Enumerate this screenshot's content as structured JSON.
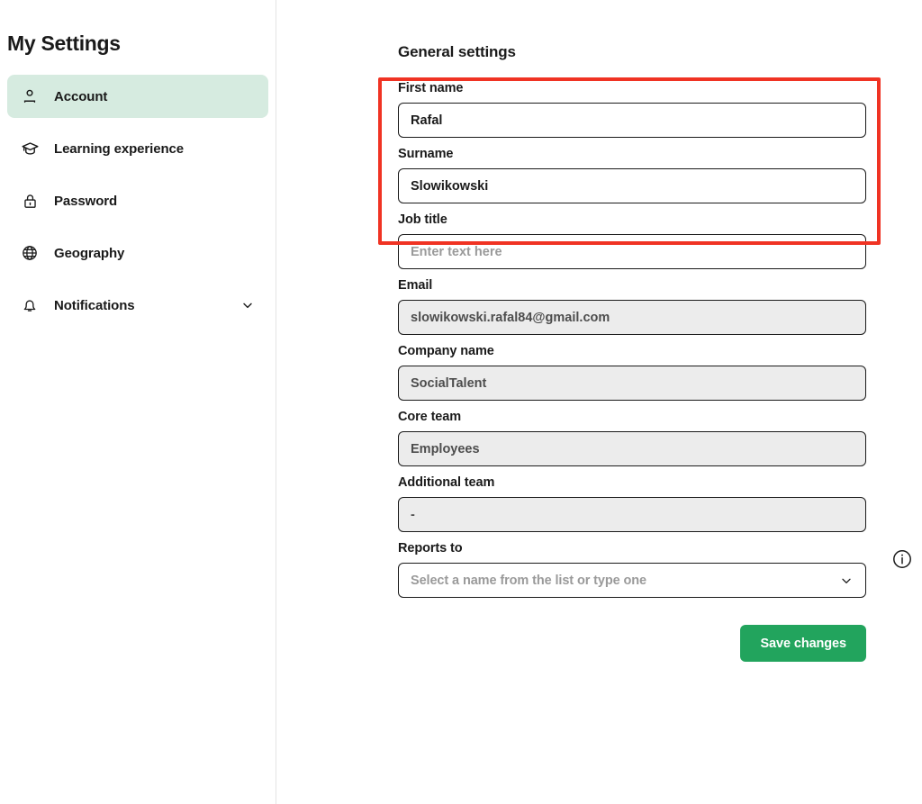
{
  "sidebar": {
    "title": "My Settings",
    "items": [
      {
        "label": "Account",
        "icon": "user-icon",
        "active": true,
        "expandable": false
      },
      {
        "label": "Learning experience",
        "icon": "graduation-cap-icon",
        "active": false,
        "expandable": false
      },
      {
        "label": "Password",
        "icon": "lock-icon",
        "active": false,
        "expandable": false
      },
      {
        "label": "Geography",
        "icon": "globe-icon",
        "active": false,
        "expandable": false
      },
      {
        "label": "Notifications",
        "icon": "bell-icon",
        "active": false,
        "expandable": true
      }
    ]
  },
  "main": {
    "section_title": "General settings",
    "fields": {
      "first_name": {
        "label": "First name",
        "value": "Rafal",
        "placeholder": "",
        "readonly": false
      },
      "surname": {
        "label": "Surname",
        "value": "Slowikowski",
        "placeholder": "",
        "readonly": false
      },
      "job_title": {
        "label": "Job title",
        "value": "",
        "placeholder": "Enter text here",
        "readonly": false
      },
      "email": {
        "label": "Email",
        "value": "slowikowski.rafal84@gmail.com",
        "placeholder": "",
        "readonly": true
      },
      "company_name": {
        "label": "Company name",
        "value": "SocialTalent",
        "placeholder": "",
        "readonly": true
      },
      "core_team": {
        "label": "Core team",
        "value": "Employees",
        "placeholder": "",
        "readonly": true
      },
      "additional_team": {
        "label": "Additional team",
        "value": "-",
        "placeholder": "",
        "readonly": true
      },
      "reports_to": {
        "label": "Reports to",
        "value": "Select a name from the list or type one"
      }
    },
    "save_label": "Save changes"
  },
  "highlight": {
    "color": "#f03323"
  },
  "colors": {
    "accent_green": "#22a45d",
    "active_nav_bg": "#d6ebe0",
    "readonly_bg": "#ececec",
    "highlight_red": "#f03323"
  }
}
